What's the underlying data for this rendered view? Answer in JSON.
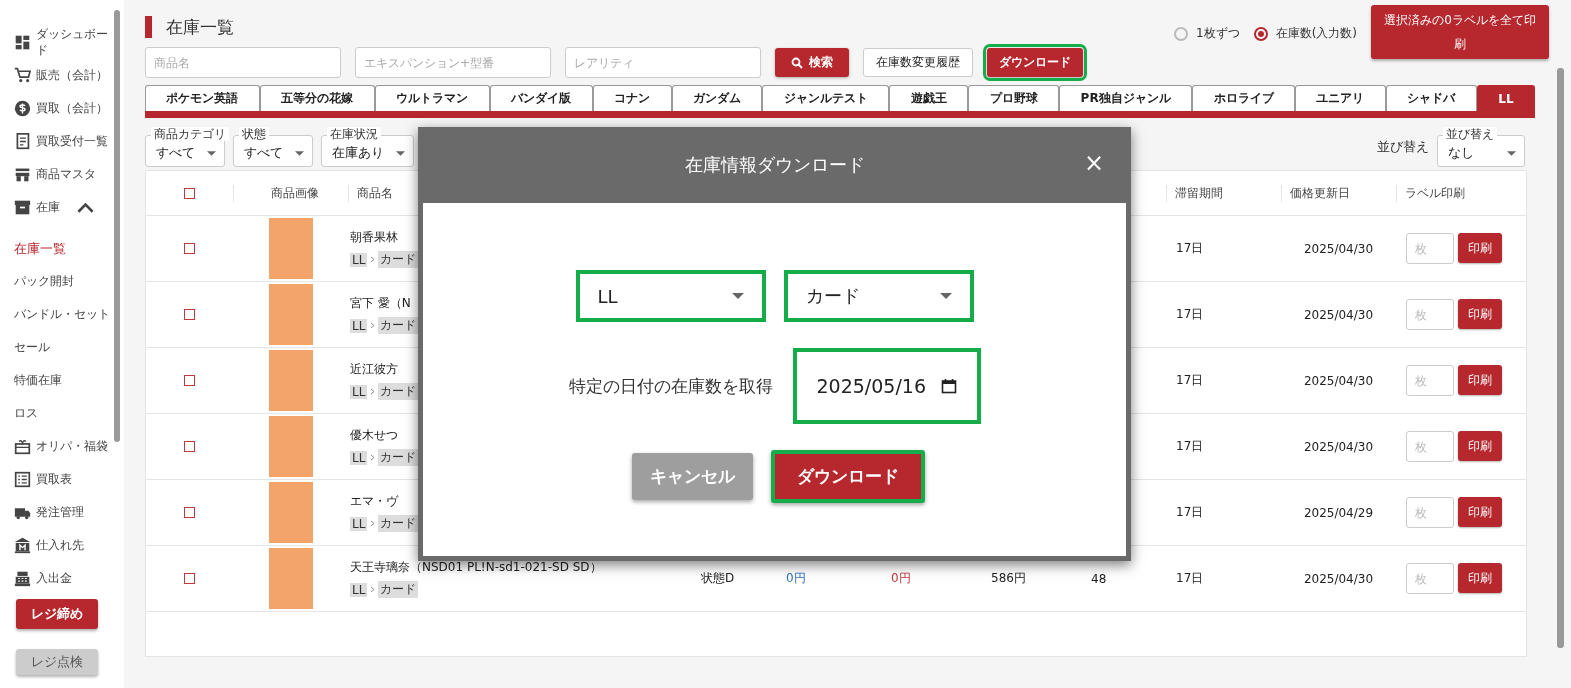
{
  "sidebar": {
    "items": [
      {
        "label": "ダッシュボード",
        "selected": false
      },
      {
        "label": "販売（会計）",
        "selected": false
      },
      {
        "label": "買取（会計）",
        "selected": false
      },
      {
        "label": "買取受付一覧",
        "selected": false
      },
      {
        "label": "商品マスタ",
        "selected": false
      },
      {
        "label": "在庫",
        "selected": false,
        "expanded": true,
        "children": [
          {
            "label": "在庫一覧",
            "selected": true
          },
          {
            "label": "パック開封",
            "selected": false
          },
          {
            "label": "バンドル・セット",
            "selected": false
          },
          {
            "label": "セール",
            "selected": false
          },
          {
            "label": "特価在庫",
            "selected": false
          },
          {
            "label": "ロス",
            "selected": false
          }
        ]
      },
      {
        "label": "オリパ・福袋",
        "selected": false
      },
      {
        "label": "買取表",
        "selected": false
      },
      {
        "label": "発注管理",
        "selected": false
      },
      {
        "label": "仕入れ先",
        "selected": false
      },
      {
        "label": "入出金",
        "selected": false
      }
    ],
    "buttons": [
      {
        "label": "レジ締め",
        "kind": "primary"
      },
      {
        "label": "レジ点検",
        "kind": "secondary"
      }
    ]
  },
  "page_title": "在庫一覧",
  "count_mode": [
    {
      "label": "1枚ずつ",
      "selected": false
    },
    {
      "label": "在庫数(入力数)",
      "selected": true
    }
  ],
  "print_all_button": "選択済みの0ラベルを全て印刷",
  "search": {
    "fields": [
      {
        "placeholder": "商品名"
      },
      {
        "placeholder": "エキスパンション+型番"
      },
      {
        "placeholder": "レアリティ"
      }
    ],
    "buttons": [
      {
        "label": "検索",
        "kind": "search",
        "highlighted": false
      },
      {
        "label": "在庫数変更履歴",
        "kind": "outline",
        "highlighted": false
      },
      {
        "label": "ダウンロード",
        "kind": "primary",
        "highlighted": true
      }
    ]
  },
  "tabs": [
    {
      "label": "ポケモン英語",
      "selected": false
    },
    {
      "label": "五等分の花嫁",
      "selected": false
    },
    {
      "label": "ウルトラマン",
      "selected": false
    },
    {
      "label": "バンダイ版",
      "selected": false
    },
    {
      "label": "コナン",
      "selected": false
    },
    {
      "label": "ガンダム",
      "selected": false
    },
    {
      "label": "ジャンルテスト",
      "selected": false
    },
    {
      "label": "遊戯王",
      "selected": false
    },
    {
      "label": "プロ野球",
      "selected": false
    },
    {
      "label": "PR独自ジャンル",
      "selected": false
    },
    {
      "label": "ホロライブ",
      "selected": false
    },
    {
      "label": "ユニアリ",
      "selected": false
    },
    {
      "label": "シャドバ",
      "selected": false
    },
    {
      "label": "LL",
      "selected": true
    }
  ],
  "filters": [
    {
      "label": "商品カテゴリ",
      "value": "すべて"
    },
    {
      "label": "状態",
      "value": "すべて"
    },
    {
      "label": "在庫状況",
      "value": "在庫あり"
    }
  ],
  "sort": {
    "caption": "並び替え",
    "label": "並び替え",
    "value": "なし"
  },
  "table": {
    "header_checked": false,
    "columns": [
      "商品画像",
      "商品名",
      "滞留期間",
      "価格更新日",
      "ラベル印刷"
    ],
    "rows": [
      {
        "checked": false,
        "name": "朝香果林",
        "tags": [
          "LL",
          "カード"
        ],
        "period": "17日",
        "updated": "2025/04/30",
        "qty_placeholder": "枚",
        "print": "印刷"
      },
      {
        "checked": false,
        "name": "宮下 愛（N",
        "tags": [
          "LL",
          "カード"
        ],
        "period": "17日",
        "updated": "2025/04/30",
        "qty_placeholder": "枚",
        "print": "印刷"
      },
      {
        "checked": false,
        "name": "近江彼方",
        "tags": [
          "LL",
          "カード"
        ],
        "period": "17日",
        "updated": "2025/04/30",
        "qty_placeholder": "枚",
        "print": "印刷"
      },
      {
        "checked": false,
        "name": "優木せつ",
        "tags": [
          "LL",
          "カード"
        ],
        "period": "17日",
        "updated": "2025/04/30",
        "qty_placeholder": "枚",
        "print": "印刷"
      },
      {
        "checked": false,
        "name": "エマ・ヴ",
        "tags": [
          "LL",
          "カード"
        ],
        "period": "17日",
        "updated": "2025/04/29",
        "qty_placeholder": "枚",
        "print": "印刷"
      },
      {
        "checked": false,
        "name": "天王寺璃奈（NSD01 PL!N-sd1-021-SD SD）",
        "tags": [
          "LL",
          "カード"
        ],
        "column_4": "状態D",
        "column_5": "0円",
        "column_6": "0円",
        "column_7": "586円",
        "column_8": "48",
        "period": "17日",
        "updated": "2025/04/30",
        "qty_placeholder": "枚",
        "print": "印刷"
      }
    ]
  },
  "dialog": {
    "title": "在庫情報ダウンロード",
    "close": "×",
    "selects": [
      {
        "value": "LL",
        "highlighted": true
      },
      {
        "value": "カード",
        "highlighted": true
      }
    ],
    "date_label": "特定の日付の在庫数を取得",
    "date_value": "2025/05/16",
    "date_highlighted": true,
    "buttons": [
      {
        "label": "キャンセル",
        "kind": "cancel",
        "highlighted": false
      },
      {
        "label": "ダウンロード",
        "kind": "primary",
        "highlighted": true
      }
    ]
  }
}
